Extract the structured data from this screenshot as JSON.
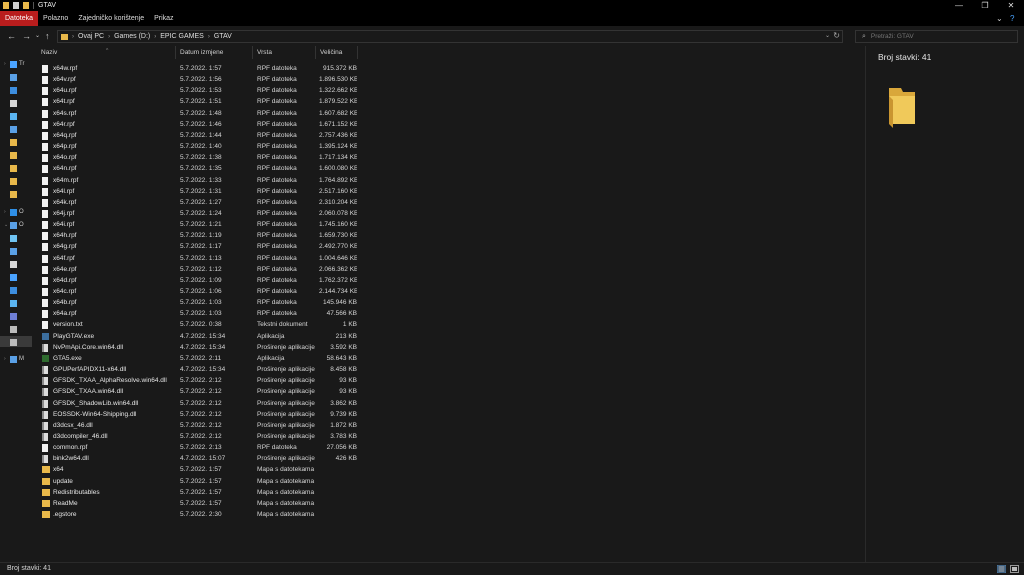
{
  "window": {
    "title": "GTAV",
    "minimize_glyph": "—",
    "maximize_glyph": "❐",
    "close_glyph": "✕"
  },
  "ribbon": {
    "tabs": [
      {
        "label": "Datoteka",
        "active": true
      },
      {
        "label": "Polazno",
        "active": false
      },
      {
        "label": "Zajedničko korištenje",
        "active": false
      },
      {
        "label": "Prikaz",
        "active": false
      }
    ],
    "expand_glyph": "⌄",
    "help_glyph": "?"
  },
  "address": {
    "back_glyph": "←",
    "forward_glyph": "→",
    "recent_glyph": "⌄",
    "up_glyph": "↑",
    "separator_glyph": "›",
    "breadcrumbs": [
      "Ovaj PC",
      "Games (D:)",
      "EPIC GAMES",
      "GTAV"
    ],
    "dropdown_glyph": "⌄",
    "refresh_glyph": "↻"
  },
  "search": {
    "placeholder": "Pretraži: GTAV",
    "icon": "search-icon"
  },
  "navpane": {
    "items": [
      {
        "label": "Tr",
        "icon": "star-icon",
        "color": "#4aa3ff",
        "chevron": "›"
      },
      {
        "label": "",
        "icon": "monitor-icon",
        "color": "#5aa0e6",
        "chevron": ""
      },
      {
        "label": "",
        "icon": "download-icon",
        "color": "#3d8ee0",
        "chevron": ""
      },
      {
        "label": "",
        "icon": "document-icon",
        "color": "#d8d8d8",
        "chevron": ""
      },
      {
        "label": "",
        "icon": "picture-icon",
        "color": "#5ab4f0",
        "chevron": ""
      },
      {
        "label": "",
        "icon": "monitor-icon",
        "color": "#5aa0e6",
        "chevron": ""
      },
      {
        "label": "",
        "icon": "folder-icon",
        "color": "#e8b84a",
        "chevron": ""
      },
      {
        "label": "",
        "icon": "folder-icon",
        "color": "#e8b84a",
        "chevron": ""
      },
      {
        "label": "",
        "icon": "folder-icon",
        "color": "#e8b84a",
        "chevron": ""
      },
      {
        "label": "",
        "icon": "folder-icon",
        "color": "#e8b84a",
        "chevron": ""
      },
      {
        "label": "",
        "icon": "folder-icon",
        "color": "#e8b84a",
        "chevron": ""
      },
      {
        "label": "O",
        "icon": "cloud-icon",
        "color": "#2f8fe6",
        "chevron": "›"
      },
      {
        "label": "O",
        "icon": "pc-icon",
        "color": "#5aa0e6",
        "chevron": "⌄"
      },
      {
        "label": "",
        "icon": "cube-icon",
        "color": "#6fc3f2",
        "chevron": ""
      },
      {
        "label": "",
        "icon": "monitor-icon",
        "color": "#5aa0e6",
        "chevron": ""
      },
      {
        "label": "",
        "icon": "document-icon",
        "color": "#d8d8d8",
        "chevron": ""
      },
      {
        "label": "",
        "icon": "music-icon",
        "color": "#4aa3ff",
        "chevron": ""
      },
      {
        "label": "",
        "icon": "download-icon",
        "color": "#3d8ee0",
        "chevron": ""
      },
      {
        "label": "",
        "icon": "picture-icon",
        "color": "#5ab4f0",
        "chevron": ""
      },
      {
        "label": "",
        "icon": "video-icon",
        "color": "#6f7fd6",
        "chevron": ""
      },
      {
        "label": "",
        "icon": "drive-icon",
        "color": "#bcbcbc",
        "chevron": ""
      },
      {
        "label": "",
        "icon": "drive-icon",
        "color": "#bcbcbc",
        "chevron": "",
        "selected": true
      },
      {
        "label": "M",
        "icon": "network-icon",
        "color": "#5aa0e6",
        "chevron": "›"
      }
    ]
  },
  "columns": {
    "name": "Naziv",
    "date": "Datum izmjene",
    "type": "Vrsta",
    "size": "Veličina",
    "sort_glyph": "^"
  },
  "files": [
    {
      "name": "x64w.rpf",
      "date": "5.7.2022. 1:57",
      "type": "RPF datoteka",
      "size": "915.372 KB",
      "kind": "file"
    },
    {
      "name": "x64v.rpf",
      "date": "5.7.2022. 1:56",
      "type": "RPF datoteka",
      "size": "1.896.530 KB",
      "kind": "file"
    },
    {
      "name": "x64u.rpf",
      "date": "5.7.2022. 1:53",
      "type": "RPF datoteka",
      "size": "1.322.662 KB",
      "kind": "file"
    },
    {
      "name": "x64t.rpf",
      "date": "5.7.2022. 1:51",
      "type": "RPF datoteka",
      "size": "1.879.522 KB",
      "kind": "file"
    },
    {
      "name": "x64s.rpf",
      "date": "5.7.2022. 1:48",
      "type": "RPF datoteka",
      "size": "1.607.682 KB",
      "kind": "file"
    },
    {
      "name": "x64r.rpf",
      "date": "5.7.2022. 1:46",
      "type": "RPF datoteka",
      "size": "1.671.152 KB",
      "kind": "file"
    },
    {
      "name": "x64q.rpf",
      "date": "5.7.2022. 1:44",
      "type": "RPF datoteka",
      "size": "2.757.436 KB",
      "kind": "file"
    },
    {
      "name": "x64p.rpf",
      "date": "5.7.2022. 1:40",
      "type": "RPF datoteka",
      "size": "1.395.124 KB",
      "kind": "file"
    },
    {
      "name": "x64o.rpf",
      "date": "5.7.2022. 1:38",
      "type": "RPF datoteka",
      "size": "1.717.134 KB",
      "kind": "file"
    },
    {
      "name": "x64n.rpf",
      "date": "5.7.2022. 1:35",
      "type": "RPF datoteka",
      "size": "1.600.080 KB",
      "kind": "file"
    },
    {
      "name": "x64m.rpf",
      "date": "5.7.2022. 1:33",
      "type": "RPF datoteka",
      "size": "1.764.892 KB",
      "kind": "file"
    },
    {
      "name": "x64l.rpf",
      "date": "5.7.2022. 1:31",
      "type": "RPF datoteka",
      "size": "2.517.160 KB",
      "kind": "file"
    },
    {
      "name": "x64k.rpf",
      "date": "5.7.2022. 1:27",
      "type": "RPF datoteka",
      "size": "2.310.204 KB",
      "kind": "file"
    },
    {
      "name": "x64j.rpf",
      "date": "5.7.2022. 1:24",
      "type": "RPF datoteka",
      "size": "2.060.078 KB",
      "kind": "file"
    },
    {
      "name": "x64i.rpf",
      "date": "5.7.2022. 1:21",
      "type": "RPF datoteka",
      "size": "1.745.160 KB",
      "kind": "file"
    },
    {
      "name": "x64h.rpf",
      "date": "5.7.2022. 1:19",
      "type": "RPF datoteka",
      "size": "1.659.730 KB",
      "kind": "file"
    },
    {
      "name": "x64g.rpf",
      "date": "5.7.2022. 1:17",
      "type": "RPF datoteka",
      "size": "2.492.770 KB",
      "kind": "file"
    },
    {
      "name": "x64f.rpf",
      "date": "5.7.2022. 1:13",
      "type": "RPF datoteka",
      "size": "1.004.646 KB",
      "kind": "file"
    },
    {
      "name": "x64e.rpf",
      "date": "5.7.2022. 1:12",
      "type": "RPF datoteka",
      "size": "2.066.362 KB",
      "kind": "file"
    },
    {
      "name": "x64d.rpf",
      "date": "5.7.2022. 1:09",
      "type": "RPF datoteka",
      "size": "1.762.372 KB",
      "kind": "file"
    },
    {
      "name": "x64c.rpf",
      "date": "5.7.2022. 1:06",
      "type": "RPF datoteka",
      "size": "2.144.734 KB",
      "kind": "file"
    },
    {
      "name": "x64b.rpf",
      "date": "5.7.2022. 1:03",
      "type": "RPF datoteka",
      "size": "145.946 KB",
      "kind": "file"
    },
    {
      "name": "x64a.rpf",
      "date": "5.7.2022. 1:03",
      "type": "RPF datoteka",
      "size": "47.566 KB",
      "kind": "file"
    },
    {
      "name": "version.txt",
      "date": "5.7.2022. 0:38",
      "type": "Tekstni dokument",
      "size": "1 KB",
      "kind": "file"
    },
    {
      "name": "PlayGTAV.exe",
      "date": "4.7.2022. 15:34",
      "type": "Aplikacija",
      "size": "213 KB",
      "kind": "app"
    },
    {
      "name": "NvPmApi.Core.win64.dll",
      "date": "4.7.2022. 15:34",
      "type": "Proširenje aplikacije",
      "size": "3.592 KB",
      "kind": "dll"
    },
    {
      "name": "GTA5.exe",
      "date": "5.7.2022. 2:11",
      "type": "Aplikacija",
      "size": "58.643 KB",
      "kind": "gta"
    },
    {
      "name": "GPUPerfAPIDX11-x64.dll",
      "date": "4.7.2022. 15:34",
      "type": "Proširenje aplikacije",
      "size": "8.458 KB",
      "kind": "dll"
    },
    {
      "name": "GFSDK_TXAA_AlphaResolve.win64.dll",
      "date": "5.7.2022. 2:12",
      "type": "Proširenje aplikacije",
      "size": "93 KB",
      "kind": "dll"
    },
    {
      "name": "GFSDK_TXAA.win64.dll",
      "date": "5.7.2022. 2:12",
      "type": "Proširenje aplikacije",
      "size": "93 KB",
      "kind": "dll"
    },
    {
      "name": "GFSDK_ShadowLib.win64.dll",
      "date": "5.7.2022. 2:12",
      "type": "Proširenje aplikacije",
      "size": "3.862 KB",
      "kind": "dll"
    },
    {
      "name": "EOSSDK-Win64-Shipping.dll",
      "date": "5.7.2022. 2:12",
      "type": "Proširenje aplikacije",
      "size": "9.739 KB",
      "kind": "dll"
    },
    {
      "name": "d3dcsx_46.dll",
      "date": "5.7.2022. 2:12",
      "type": "Proširenje aplikacije",
      "size": "1.872 KB",
      "kind": "dll"
    },
    {
      "name": "d3dcompiler_46.dll",
      "date": "5.7.2022. 2:12",
      "type": "Proširenje aplikacije",
      "size": "3.783 KB",
      "kind": "dll"
    },
    {
      "name": "common.rpf",
      "date": "5.7.2022. 2:13",
      "type": "RPF datoteka",
      "size": "27.056 KB",
      "kind": "file"
    },
    {
      "name": "bink2w64.dll",
      "date": "4.7.2022. 15:07",
      "type": "Proširenje aplikacije",
      "size": "426 KB",
      "kind": "dll"
    },
    {
      "name": "x64",
      "date": "5.7.2022. 1:57",
      "type": "Mapa s datotekama",
      "size": "",
      "kind": "folder"
    },
    {
      "name": "update",
      "date": "5.7.2022. 1:57",
      "type": "Mapa s datotekama",
      "size": "",
      "kind": "folder"
    },
    {
      "name": "Redistributables",
      "date": "5.7.2022. 1:57",
      "type": "Mapa s datotekama",
      "size": "",
      "kind": "folder"
    },
    {
      "name": "ReadMe",
      "date": "5.7.2022. 1:57",
      "type": "Mapa s datotekama",
      "size": "",
      "kind": "folder"
    },
    {
      "name": ".egstore",
      "date": "5.7.2022. 2:30",
      "type": "Mapa s datotekama",
      "size": "",
      "kind": "folder"
    }
  ],
  "details": {
    "title": "Broj stavki: 41"
  },
  "status": {
    "text": "Broj stavki: 41"
  },
  "colors": {
    "accent_red": "#b91d1d",
    "folder_yellow": "#e8b84a",
    "background": "#191919"
  }
}
